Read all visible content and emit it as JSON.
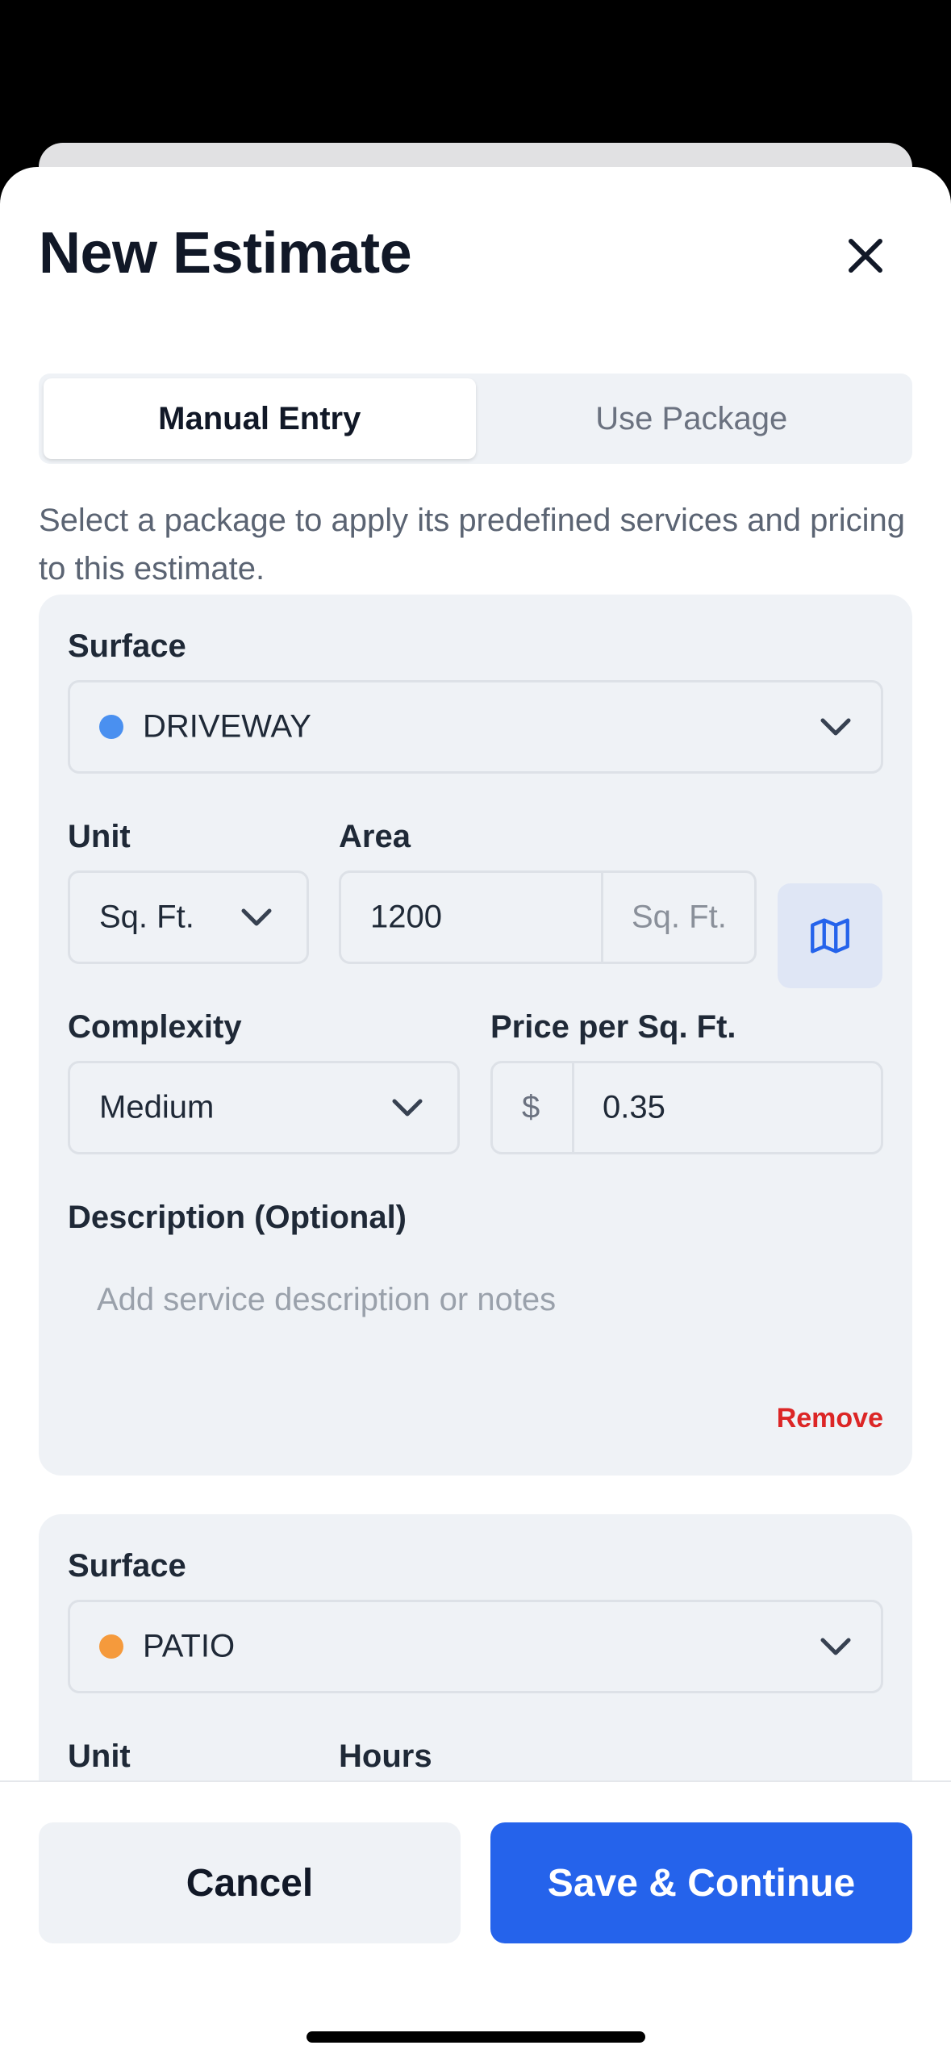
{
  "modal": {
    "title": "New Estimate"
  },
  "tabs": [
    {
      "label": "Manual Entry",
      "active": true
    },
    {
      "label": "Use Package",
      "active": false
    }
  ],
  "helper_text": "Select a package to apply its predefined services and pricing to this estimate.",
  "service_1": {
    "surface_label": "Surface",
    "surface_value": "DRIVEWAY",
    "surface_color": "#4a90f0",
    "unit_label": "Unit",
    "unit_value": "Sq. Ft.",
    "area_label": "Area",
    "area_value": "1200",
    "area_suffix": "Sq. Ft.",
    "map_icon": "map-icon",
    "complexity_label": "Complexity",
    "complexity_value": "Medium",
    "price_label": "Price per Sq. Ft.",
    "price_prefix": "$",
    "price_value": "0.35",
    "description_label": "Description (Optional)",
    "description_placeholder": "Add service description or notes",
    "remove_label": "Remove"
  },
  "service_2": {
    "surface_label": "Surface",
    "surface_value": "PATIO",
    "surface_color": "#f59a3c",
    "unit_label": "Unit",
    "hours_label": "Hours"
  },
  "footer": {
    "cancel_label": "Cancel",
    "save_label": "Save & Continue"
  },
  "colors": {
    "accent": "#2563eb",
    "danger": "#dc2626"
  }
}
